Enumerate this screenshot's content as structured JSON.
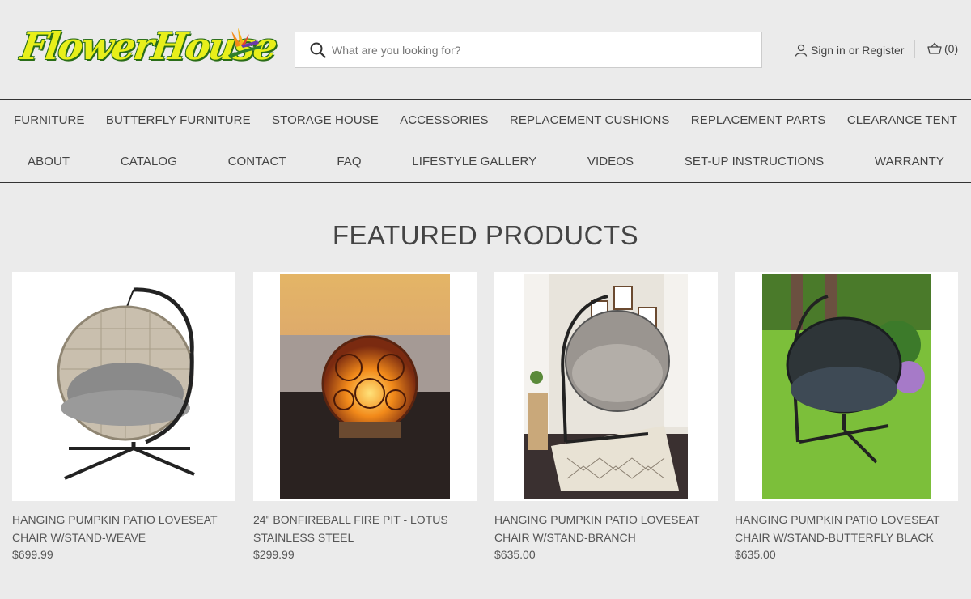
{
  "logo": {
    "text": "FlowerHouse"
  },
  "search": {
    "placeholder": "What are you looking for?",
    "value": ""
  },
  "account": {
    "sign_in": "Sign in",
    "or": "or",
    "register": "Register"
  },
  "cart": {
    "count_label": "(0)"
  },
  "nav": {
    "row1": [
      "FURNITURE",
      "BUTTERFLY FURNITURE",
      "STORAGE HOUSE",
      "ACCESSORIES",
      "REPLACEMENT CUSHIONS",
      "REPLACEMENT PARTS",
      "CLEARANCE TENT"
    ],
    "row2": [
      "ABOUT",
      "CATALOG",
      "CONTACT",
      "FAQ",
      "LIFESTYLE GALLERY",
      "VIDEOS",
      "SET-UP INSTRUCTIONS",
      "WARRANTY"
    ]
  },
  "featured": {
    "title": "FEATURED PRODUCTS"
  },
  "products": [
    {
      "name": "HANGING PUMPKIN PATIO LOVESEAT CHAIR W/STAND-WEAVE",
      "price": "$699.99",
      "image": "hanging-chair-weave-image"
    },
    {
      "name": "24\" BONFIREBALL FIRE PIT - LOTUS STAINLESS STEEL",
      "price": "$299.99",
      "image": "fire-pit-image"
    },
    {
      "name": "HANGING PUMPKIN PATIO LOVESEAT CHAIR W/STAND-BRANCH",
      "price": "$635.00",
      "image": "hanging-chair-branch-image"
    },
    {
      "name": "HANGING PUMPKIN PATIO LOVESEAT CHAIR W/STAND-BUTTERFLY BLACK",
      "price": "$635.00",
      "image": "hanging-chair-butterfly-image"
    }
  ],
  "colors": {
    "background": "#ebebeb",
    "text": "#444444",
    "logo_yellow": "#e8ef1a",
    "logo_green": "#2a6d18"
  }
}
